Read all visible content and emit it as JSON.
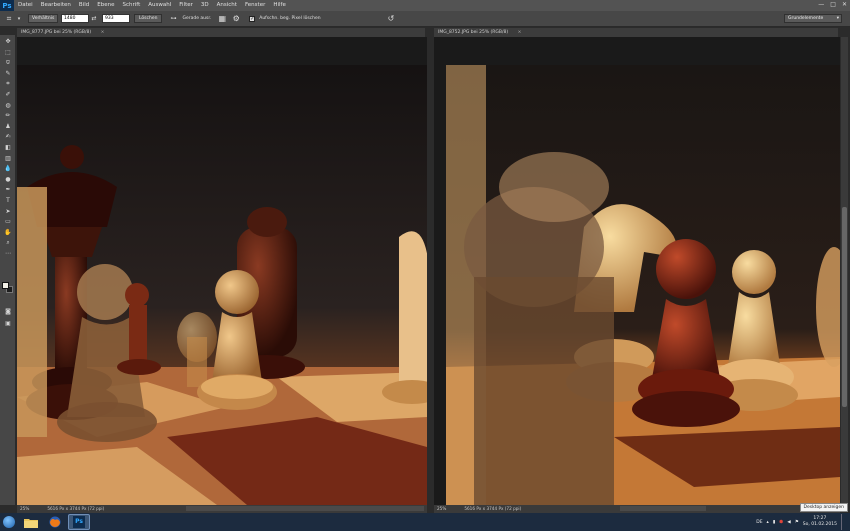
{
  "app": {
    "logo": "Ps"
  },
  "menu": [
    "Datei",
    "Bearbeiten",
    "Bild",
    "Ebene",
    "Schrift",
    "Auswahl",
    "Filter",
    "3D",
    "Ansicht",
    "Fenster",
    "Hilfe"
  ],
  "window_controls": {
    "minimize": "—",
    "maximize": "□",
    "close": "✕"
  },
  "options": {
    "ratio_mode": "Verhältnis",
    "width_value": "1480",
    "height_value": "933",
    "clear_button": "Löschen",
    "straighten_label": "Gerade ausr.",
    "delete_pixels_checked": true,
    "delete_pixels_label": "Aufschn. beg. Pixel löschen",
    "workspace": "Grundelemente"
  },
  "tools": [
    "move",
    "marquee",
    "lasso",
    "quick-select",
    "crop",
    "eyedropper",
    "spot-heal",
    "brush",
    "clone-stamp",
    "history-brush",
    "eraser",
    "gradient",
    "blur",
    "dodge",
    "pen",
    "type",
    "path-select",
    "rectangle",
    "hand",
    "zoom",
    "more"
  ],
  "colors": {
    "foreground": "#f2f0e6",
    "background": "#1e1e1e",
    "chrome": "#535353",
    "panel": "#474747",
    "taskbar": "#1c2b3f"
  },
  "documents": [
    {
      "tab_title": "IMG_8777.JPG bei 25% (RGB/8)",
      "zoom": "25%",
      "dims": "5616 Px x 3744 Px (72 ppi)"
    },
    {
      "tab_title": "IMG_8752.JPG bei 25% (RGB/8)",
      "zoom": "25%",
      "dims": "5616 Px x 3744 Px (72 ppi)"
    }
  ],
  "taskbar": {
    "apps": [
      "windows-explorer",
      "firefox",
      "photoshop"
    ],
    "language": "DE",
    "time": "17:27",
    "date": "So, 01.02.2015",
    "show_desktop_tooltip": "Desktop anzeigen"
  }
}
